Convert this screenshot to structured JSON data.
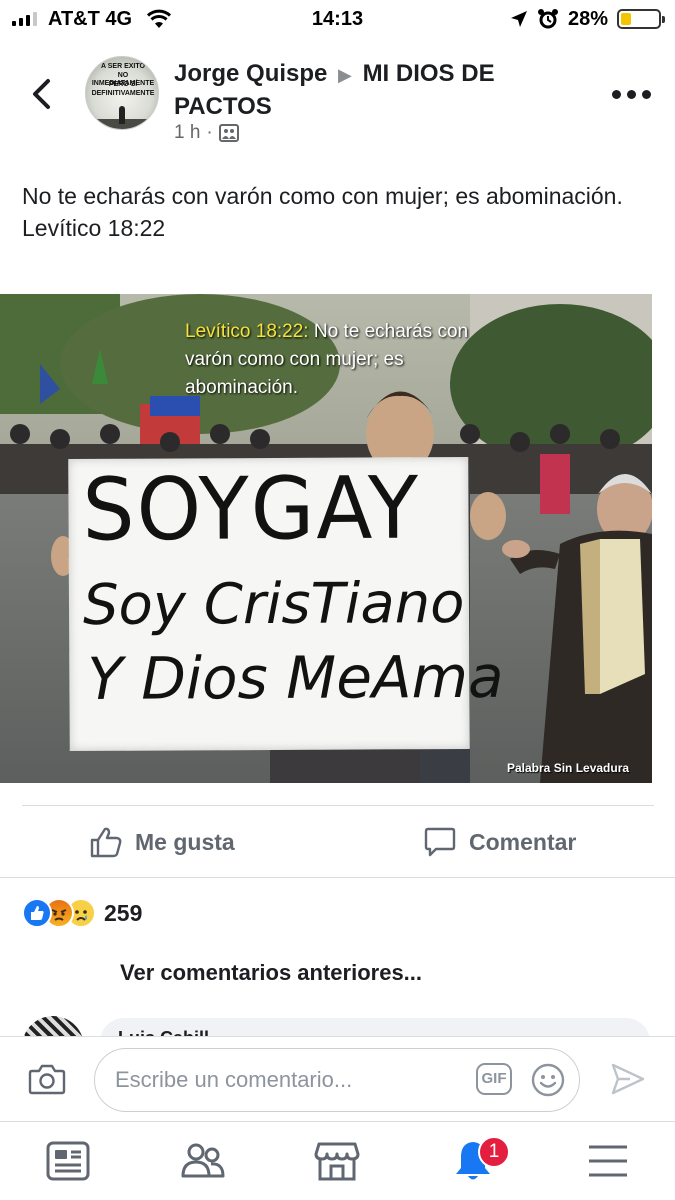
{
  "status_bar": {
    "carrier": "AT&T 4G",
    "time": "14:13",
    "battery_percent": "28%",
    "battery_level": 0.28,
    "icons": [
      "signal-icon",
      "wifi-icon",
      "location-arrow-icon",
      "alarm-icon",
      "battery-icon"
    ]
  },
  "post": {
    "author": "Jorge Quispe",
    "separator": "▶",
    "group": "MI DIOS DE PACTOS",
    "avatar_text": [
      "A SER EXITO",
      "NO INMEDIATAMENTE",
      "PERO SÍ",
      "DEFINITIVAMENTE"
    ],
    "time_ago": "1 h",
    "dot": "·",
    "text": "No te echarás con varón como con mujer; es abominación.\nLevítico 18:22",
    "image": {
      "overlay_ref": "Levítico 18:22:",
      "overlay_text": " No te echarás con varón como con mujer; es abominación.",
      "sign_line1": "SOYGAY",
      "sign_line2": "Soy CrisTiano",
      "sign_line3": "Y Dios MeAma",
      "watermark": "Palabra Sin Levadura"
    }
  },
  "actions": {
    "like_label": "Me gusta",
    "comment_label": "Comentar"
  },
  "reactions": {
    "types": [
      "like",
      "angry",
      "sad"
    ],
    "count": "259"
  },
  "comments": {
    "view_previous": "Ver comentarios anteriores...",
    "partial_name": "Luis Cabill..."
  },
  "composer": {
    "placeholder": "Escribe un comentario...",
    "gif_label": "GIF"
  },
  "tabbar": {
    "tabs": [
      "news-feed",
      "friends",
      "marketplace",
      "notifications",
      "menu"
    ],
    "notification_badge": "1"
  },
  "colors": {
    "brand_blue": "#1877f2",
    "badge_red": "#e41e3f",
    "text": "#1c1e21",
    "muted": "#65676b",
    "battery_fill": "#f5c400"
  }
}
